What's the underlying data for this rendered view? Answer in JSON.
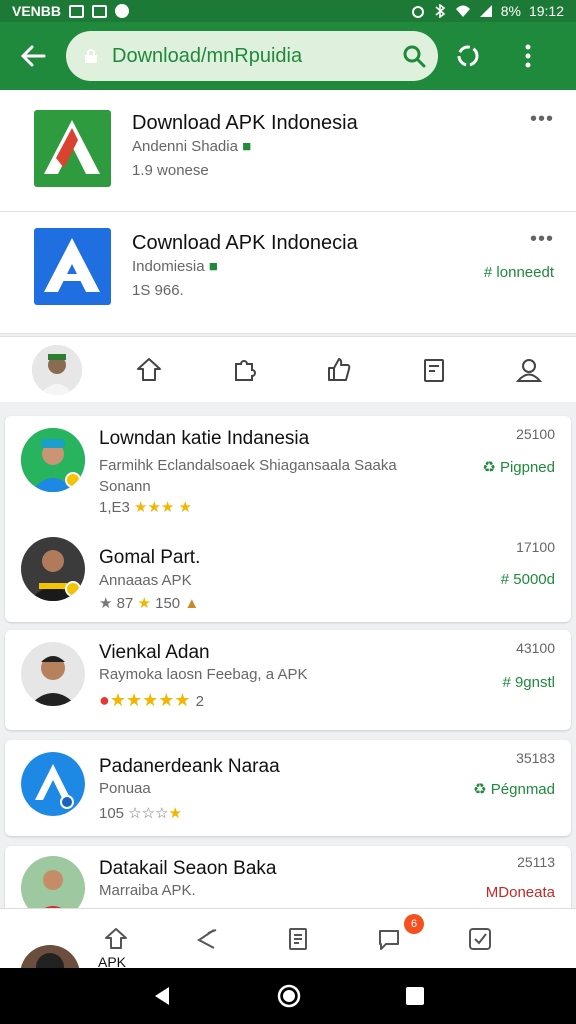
{
  "status_bar": {
    "left_text": "VENBB",
    "time": "19:12",
    "battery": "8%"
  },
  "address_bar": {
    "url": "Download/mnRpuidia"
  },
  "featured": [
    {
      "title": "Download APK Indonesia",
      "subtitle": "Andenni Shadia",
      "meta": "1.9 wonese",
      "icon": "apk-logo-green"
    },
    {
      "title": "Cownload APK Indonecia",
      "subtitle": "Indomiesia",
      "meta": "1S 966.",
      "badge": "# lonneedt",
      "icon": "apk-logo-blue"
    }
  ],
  "list": [
    {
      "title": "Lowndan katie Indanesia",
      "subtitle": "Farmihk Eclandalsoaek Shiagansaala Saaka",
      "subtitle2": "Sonann",
      "rating": "1,E3",
      "count": "25100",
      "badge": "Pigpned",
      "badge_color": "#1f8a3c"
    },
    {
      "title": "Gomal Part.",
      "subtitle": "Annaaas APK",
      "rating": "87",
      "rating2": "150",
      "count": "17100",
      "badge": "# 5000d",
      "badge_color": "#1f8a3c"
    },
    {
      "title": "Vienkal Adan",
      "subtitle": "Raymoka laosn Feebag, a APK",
      "rating": "",
      "rating2": "2",
      "count": "43100",
      "badge": "# 9gnstl",
      "badge_color": "#1f8a3c"
    },
    {
      "title": "Padanerdeank Naraa",
      "subtitle": "Ponuaa",
      "rating": "105",
      "count": "35183",
      "badge": "Pégnmad",
      "badge_color": "#1f8a3c"
    },
    {
      "title": "Datakail Seaon Baka",
      "subtitle": "Marraiba APK.",
      "count": "25113",
      "badge": "MDoneata",
      "badge_color": "#c62828"
    }
  ],
  "bottom_peek_label": "APK",
  "notification_badge": "6",
  "colors": {
    "primary": "#1f8a3c",
    "url_bg": "#dff0dc"
  }
}
